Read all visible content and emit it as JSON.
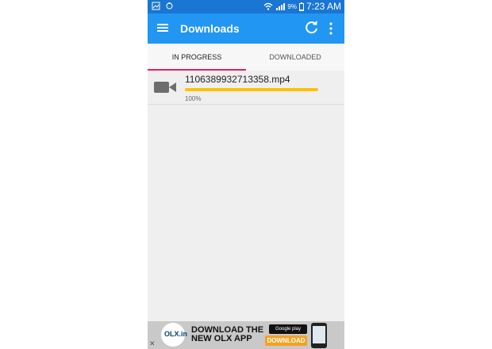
{
  "status_bar": {
    "battery_percent": "9%",
    "time": "7:23 AM"
  },
  "app_bar": {
    "title": "Downloads"
  },
  "tabs": [
    {
      "label": "IN PROGRESS",
      "active": true
    },
    {
      "label": "DOWNLOADED",
      "active": false
    }
  ],
  "downloads": [
    {
      "filename": "1106389932713358.mp4",
      "progress_percent": 100,
      "progress_label": "100%"
    }
  ],
  "ad": {
    "close_label": "✕",
    "logo_text": "OLX.in",
    "headline_line1": "DOWNLOAD THE",
    "headline_line2": "NEW OLX APP",
    "store_badge": "Google play",
    "cta_label": "DOWNLOAD"
  },
  "colors": {
    "status_bar": "#1976d2",
    "app_bar": "#2196f3",
    "tab_indicator": "#e91e63",
    "progress_fill": "#ffc107",
    "background": "#efefef"
  }
}
